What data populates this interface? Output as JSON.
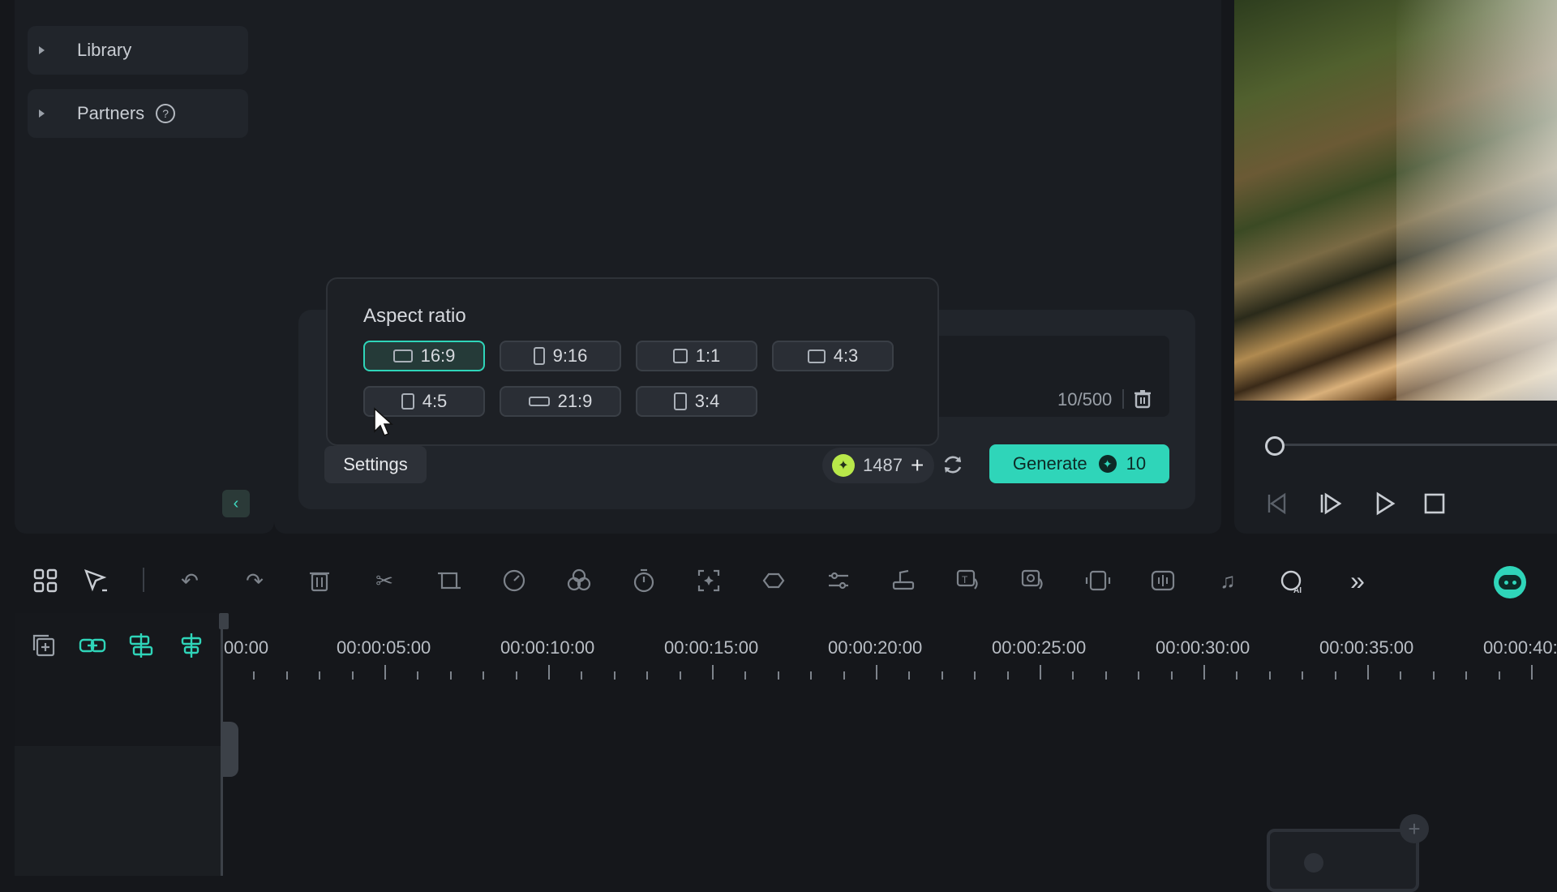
{
  "sidebar": {
    "items": [
      {
        "label": "Library"
      },
      {
        "label": "Partners",
        "help_icon": "help-icon"
      }
    ],
    "collapse_icon": "chevron-left-icon"
  },
  "aspect_ratio": {
    "title": "Aspect ratio",
    "options": [
      {
        "label": "16:9",
        "icon": "landscape-icon",
        "selected": true
      },
      {
        "label": "9:16",
        "icon": "portrait-icon",
        "selected": false
      },
      {
        "label": "1:1",
        "icon": "square-icon",
        "selected": false
      },
      {
        "label": "4:3",
        "icon": "landscape-icon",
        "selected": false
      },
      {
        "label": "4:5",
        "icon": "portrait-icon",
        "selected": false
      },
      {
        "label": "21:9",
        "icon": "wide-icon",
        "selected": false
      },
      {
        "label": "3:4",
        "icon": "portrait-icon",
        "selected": false
      }
    ]
  },
  "prompt": {
    "char_count": "10/500"
  },
  "actions": {
    "settings_label": "Settings",
    "credits": "1487",
    "generate_label": "Generate",
    "generate_cost": "10"
  },
  "timeline": {
    "labels": [
      "00:00",
      "00:00:05:00",
      "00:00:10:00",
      "00:00:15:00",
      "00:00:20:00",
      "00:00:25:00",
      "00:00:30:00",
      "00:00:35:00",
      "00:00:40:"
    ]
  },
  "colors": {
    "accent": "#2fd5b9",
    "background": "#15171b",
    "panel": "#1a1d22",
    "credit_coin": "#b8e84a"
  }
}
